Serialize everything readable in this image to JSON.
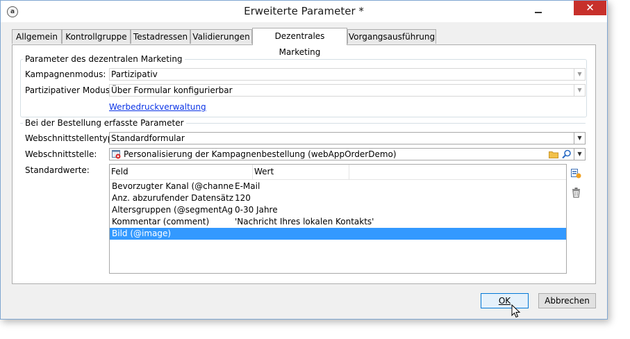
{
  "window": {
    "title": "Erweiterte Parameter *",
    "close_glyph": "✕",
    "icon": "app-icon"
  },
  "tabs": [
    {
      "label": "Allgemein"
    },
    {
      "label": "Kontrollgruppe"
    },
    {
      "label": "Testadressen"
    },
    {
      "label": "Validierungen"
    },
    {
      "label": "Dezentrales Marketing",
      "active": true
    },
    {
      "label": "Vorgangsausführung"
    }
  ],
  "group_marketing": {
    "legend": "Parameter des dezentralen Marketing",
    "campaign_mode_label": "Kampagnenmodus:",
    "campaign_mode_value": "Partizipativ",
    "participative_mode_label": "Partizipativer Modus:",
    "participative_mode_value": "Über Formular konfigurierbar",
    "link": "Werbedruckverwaltung"
  },
  "group_order": {
    "legend": "Bei der Bestellung erfasste Parameter",
    "interface_type_label": "Webschnittstellentyp:",
    "interface_type_value": "Standardformular",
    "interface_label": "Webschnittstelle:",
    "interface_value": "Personalisierung der Kampagnenbestellung  (webAppOrderDemo)",
    "defaults_label": "Standardwerte:"
  },
  "defaults_table": {
    "columns": [
      "Feld",
      "Wert"
    ],
    "rows": [
      {
        "field": "Bevorzugter Kanal (@channel)",
        "value": "E-Mail"
      },
      {
        "field": "Anz. abzurufender Datensätze (...",
        "value": "120"
      },
      {
        "field": "Altersgruppen (@segmentAge)",
        "value": "0-30 Jahre"
      },
      {
        "field": "Kommentar (comment)",
        "value": "'Nachricht Ihres lokalen Kontakts'"
      },
      {
        "field": "Bild (@image)",
        "value": "",
        "selected": true
      }
    ]
  },
  "buttons": {
    "ok": "OK",
    "cancel": "Abbrechen"
  },
  "colors": {
    "selection": "#3399ff",
    "link": "#0a33e6",
    "close_button": "#c7302b"
  }
}
